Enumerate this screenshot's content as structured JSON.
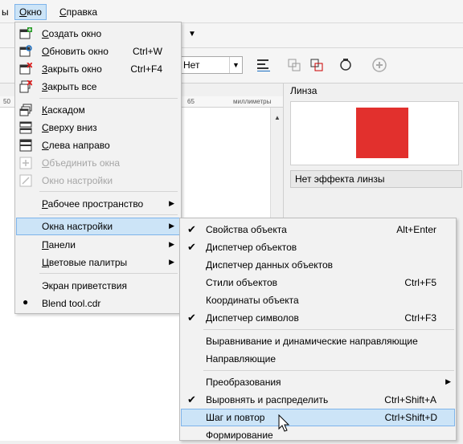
{
  "menubar": {
    "items": [
      {
        "label": "ы",
        "u": ""
      },
      {
        "label": "кно",
        "u": "О"
      },
      {
        "label": "правка",
        "u": "С"
      }
    ]
  },
  "toolbar": {
    "outline_select_value": "Нет"
  },
  "ruler": {
    "mark_50": "50",
    "mark_65": "65",
    "unit": "миллиметры"
  },
  "docker": {
    "title": "Линза",
    "lens_effect_value": "Нет эффекта линзы",
    "swatch_color": "#e2302d"
  },
  "window_menu": {
    "items": [
      {
        "u": "С",
        "rest": "оздать окно",
        "shortcut": "",
        "icon": "new-window-icon"
      },
      {
        "u": "О",
        "rest": "бновить окно",
        "shortcut": "Ctrl+W",
        "icon": "refresh-window-icon"
      },
      {
        "u": "З",
        "rest": "акрыть окно",
        "shortcut": "Ctrl+F4",
        "icon": "close-window-icon"
      },
      {
        "u": "З",
        "rest": "акрыть все",
        "shortcut": "",
        "icon": "close-all-icon"
      },
      {
        "u": "К",
        "rest": "аскадом",
        "shortcut": "",
        "icon": "cascade-icon"
      },
      {
        "u": "С",
        "rest": "верху вниз",
        "shortcut": "",
        "icon": "tile-horizontal-icon"
      },
      {
        "u": "С",
        "rest": "лева направо",
        "shortcut": "",
        "icon": "tile-vertical-icon"
      },
      {
        "u": "О",
        "rest": "бъединить окна",
        "shortcut": "",
        "icon": "combine-windows-icon"
      },
      {
        "u": "",
        "rest": "Окно настройки",
        "shortcut": "",
        "icon": "docker-window-icon"
      },
      {
        "u": "Р",
        "rest": "абочее пространство",
        "shortcut": "",
        "icon": ""
      },
      {
        "u": "",
        "rest": "Окна настройки",
        "shortcut": "",
        "icon": ""
      },
      {
        "u": "П",
        "rest": "анели",
        "shortcut": "",
        "icon": ""
      },
      {
        "u": "Ц",
        "rest": "ветовые палитры",
        "shortcut": "",
        "icon": ""
      },
      {
        "u": "",
        "rest": "Экран приветствия",
        "shortcut": "",
        "icon": ""
      },
      {
        "u": "",
        "rest": "Blend tool.cdr",
        "shortcut": "",
        "icon": "bullet"
      }
    ]
  },
  "dockers_submenu": {
    "items": [
      {
        "label": "Свойства объекта",
        "shortcut": "Alt+Enter",
        "checked": true
      },
      {
        "label": "Диспетчер объектов",
        "shortcut": "",
        "checked": true
      },
      {
        "label": "Диспетчер данных объектов",
        "shortcut": "",
        "checked": false
      },
      {
        "label": "Стили объектов",
        "shortcut": "Ctrl+F5",
        "checked": false
      },
      {
        "label": "Координаты объекта",
        "shortcut": "",
        "checked": false
      },
      {
        "label": "Диспетчер символов",
        "shortcut": "Ctrl+F3",
        "checked": true
      },
      {
        "label": "Выравнивание и динамические направляющие",
        "shortcut": "",
        "checked": false
      },
      {
        "label": "Направляющие",
        "shortcut": "",
        "checked": false
      },
      {
        "label": "Преобразования",
        "shortcut": "",
        "checked": false
      },
      {
        "label": "Выровнять и распределить",
        "shortcut": "Ctrl+Shift+A",
        "checked": true
      },
      {
        "label": "Шаг и повтор",
        "shortcut": "Ctrl+Shift+D",
        "checked": false
      },
      {
        "label": "Формирование",
        "shortcut": "",
        "checked": false
      }
    ]
  },
  "colors": {
    "highlight": "#cce4f7",
    "highlight_border": "#7eb4ea"
  }
}
